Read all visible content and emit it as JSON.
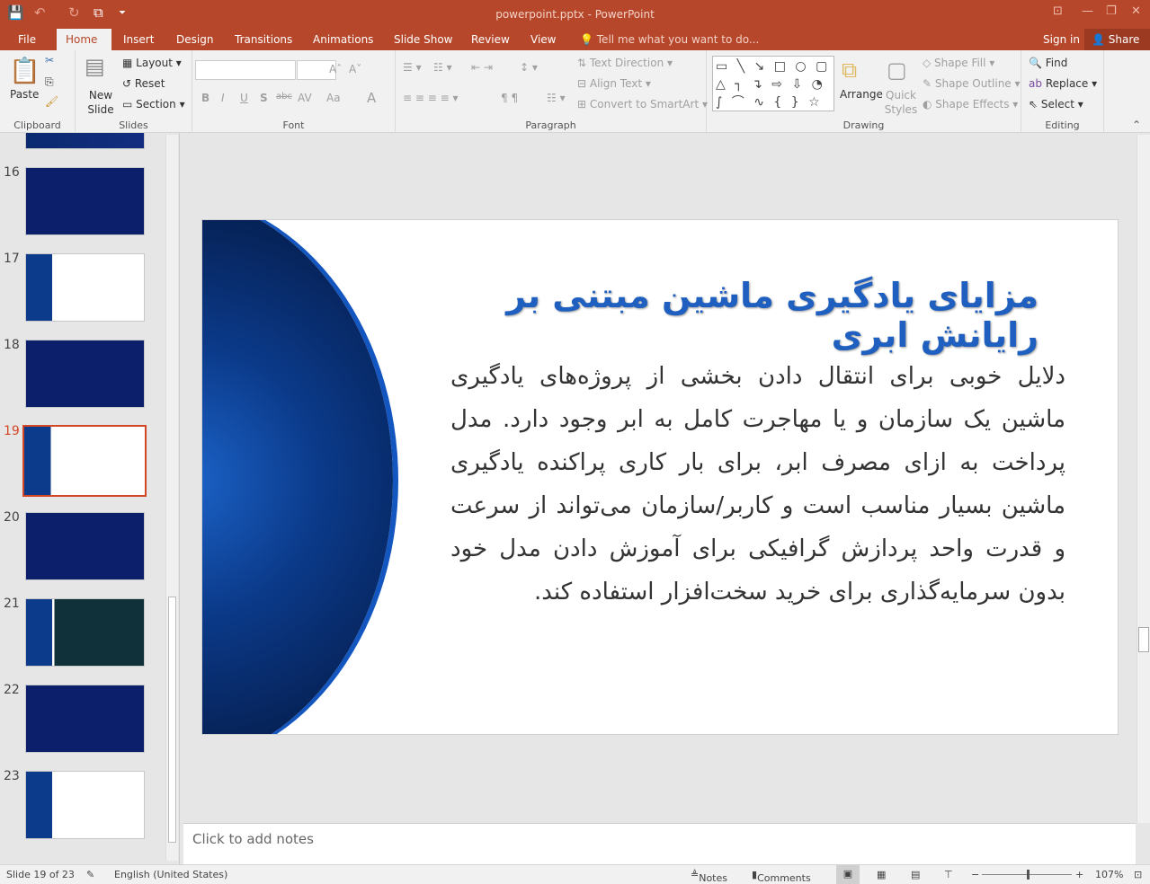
{
  "window": {
    "title": "powerpoint.pptx - PowerPoint"
  },
  "quick_access": {
    "save": "💾",
    "undo": "↶",
    "redo": "↻",
    "present": "⧉",
    "more": "⏷"
  },
  "tabs": [
    "File",
    "Home",
    "Insert",
    "Design",
    "Transitions",
    "Animations",
    "Slide Show",
    "Review",
    "View"
  ],
  "tell_me": "Tell me what you want to do...",
  "sign_in": "Sign in",
  "share": "Share",
  "ribbon": {
    "clipboard": {
      "label": "Clipboard",
      "paste": "Paste"
    },
    "slides": {
      "label": "Slides",
      "new_slide": "New Slide",
      "layout": "Layout",
      "reset": "Reset",
      "section": "Section"
    },
    "font": {
      "label": "Font",
      "bold": "B",
      "italic": "I",
      "underline": "U",
      "shadow": "S",
      "strike": "abc",
      "spacing": "AV",
      "case": "Aa",
      "color": "A",
      "grow": "Aˆ",
      "shrink": "Aˇ"
    },
    "paragraph": {
      "label": "Paragraph",
      "text_direction": "Text Direction",
      "align_text": "Align Text",
      "convert_smartart": "Convert to SmartArt"
    },
    "drawing": {
      "label": "Drawing",
      "arrange": "Arrange",
      "quick_styles": "Quick Styles",
      "shape_fill": "Shape Fill",
      "shape_outline": "Shape Outline",
      "shape_effects": "Shape Effects",
      "shapes": "▭ ╲ ↘ □ ○ ▢ △ ┐ ↴ ⇨ ⇩ ◔ ∫ ⌒ ∿ { } ☆"
    },
    "editing": {
      "label": "Editing",
      "find": "Find",
      "replace": "Replace",
      "select": "Select"
    }
  },
  "thumbnails": [
    {
      "num": "16"
    },
    {
      "num": "17"
    },
    {
      "num": "18"
    },
    {
      "num": "19",
      "selected": true
    },
    {
      "num": "20"
    },
    {
      "num": "21"
    },
    {
      "num": "22"
    },
    {
      "num": "23"
    }
  ],
  "slide": {
    "title": "مزایای یادگیری ماشین مبتنی بر رایانش ابری",
    "body": "دلایل خوبی برای انتقال دادن بخشی از پروژه‌های یادگیری ماشین یک سازمان و یا مهاجرت کامل به ابر وجود دارد. مدل پرداخت به ازای مصرف ابر، برای بار کاری پراکنده یادگیری ماشین بسیار مناسب است و کاربر/سازمان می‌تواند از سرعت و قدرت واحد پردازش گرافیکی برای آموزش دادن مدل خود بدون سرمایه‌گذاری برای خرید سخت‌افزار استفاده کند."
  },
  "notes_placeholder": "Click to add notes",
  "status": {
    "slide": "Slide 19 of 23",
    "language": "English (United States)",
    "notes": "Notes",
    "comments": "Comments",
    "zoom": "107%",
    "zoom_level": 107
  },
  "colors": {
    "accent": "#b7472a",
    "title_blue": "#1f5fbf"
  }
}
